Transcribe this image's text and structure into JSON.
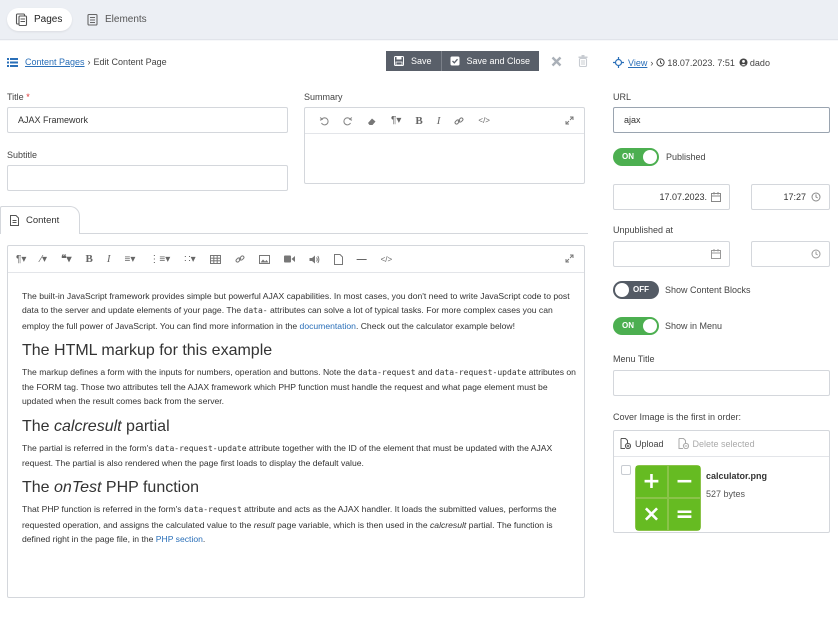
{
  "top_tabs": [
    {
      "label": "Pages",
      "active": true
    },
    {
      "label": "Elements",
      "active": false
    }
  ],
  "breadcrumb": {
    "root": "Content Pages",
    "separator": "›",
    "current": "Edit Content Page"
  },
  "toolbar": {
    "save": "Save",
    "save_and_close": "Save and Close"
  },
  "meta": {
    "view": "View",
    "separator": "›",
    "timestamp": "18.07.2023. 7:51",
    "user": "dado"
  },
  "fields": {
    "title_label": "Title",
    "title_required": "*",
    "title_value": "AJAX Framework",
    "subtitle_label": "Subtitle",
    "subtitle_value": "",
    "summary_label": "Summary",
    "url_label": "URL",
    "url_value": "ajax"
  },
  "published": {
    "toggle_text": "ON",
    "label": "Published",
    "date": "17.07.2023.",
    "time": "17:27"
  },
  "unpublished": {
    "label": "Unpublished at",
    "date": "",
    "time": ""
  },
  "content_blocks": {
    "toggle_text": "OFF",
    "label": "Show Content Blocks"
  },
  "show_in_menu": {
    "toggle_text": "ON",
    "label": "Show in Menu"
  },
  "menu_title": {
    "label": "Menu Title",
    "value": ""
  },
  "cover": {
    "label": "Cover Image is the first in order:",
    "upload": "Upload",
    "delete_selected": "Delete selected",
    "file_name": "calculator.png",
    "file_size": "527 bytes"
  },
  "content_tab": "Content",
  "content": {
    "p1_a": "The built-in JavaScript framework provides simple but powerful AJAX capabilities. In most cases, you don't need to write JavaScript code to post data to the server and update elements of your page. The ",
    "p1_code": "data-",
    "p1_b": " attributes can solve a lot of typical tasks. For more complex cases you can employ the full power of JavaScript. You can find more information in the ",
    "p1_link": "documentation",
    "p1_c": ". Check out the calculator example below!",
    "h1": "The HTML markup for this example",
    "p2_a": "The markup defines a form with the inputs for numbers, operation and buttons. Note the ",
    "p2_code1": "data-request",
    "p2_b": " and ",
    "p2_code2": "data-request-update",
    "p2_c": " attributes on the FORM tag. Those two attributes tell the AJAX framework which PHP function must handle the request and what page element must be updated when the result comes back from the server.",
    "h2_a": "The ",
    "h2_em": "calcresult",
    "h2_b": " partial",
    "p3_a": "The partial is referred in the form's ",
    "p3_code": "data-request-update",
    "p3_b": " attribute together with the ID of the element that must be updated with the AJAX request. The partial is also rendered when the page first loads to display the default value.",
    "h3_a": "The ",
    "h3_em": "onTest",
    "h3_b": " PHP function",
    "p4_a": "That PHP function is referred in the form's ",
    "p4_code": "data-request",
    "p4_b": " attribute and acts as the AJAX handler. It loads the submitted values, performs the requested operation, and assigns the calculated value to the ",
    "p4_em1": "result",
    "p4_c": " page variable, which is then used in the ",
    "p4_em2": "calcresult",
    "p4_d": " partial. The function is defined right in the page file, in the ",
    "p4_link": "PHP section",
    "p4_e": "."
  },
  "colors": {
    "accent": "#2a6fb8",
    "toggle_on": "#4caf50",
    "toggle_off": "#545b65",
    "save_button": "#595f69",
    "required": "#dd3333"
  },
  "icons": {
    "pages": "pages-icon",
    "elements": "elements-icon",
    "list": "list-icon",
    "save": "save-icon",
    "save_close": "check-icon",
    "close": "close-icon",
    "trash": "trash-icon",
    "view": "view-icon",
    "history": "history-icon",
    "user": "user-icon",
    "calendar": "calendar-icon",
    "clock": "clock-icon",
    "upload": "upload-icon",
    "delete": "delete-icon"
  }
}
